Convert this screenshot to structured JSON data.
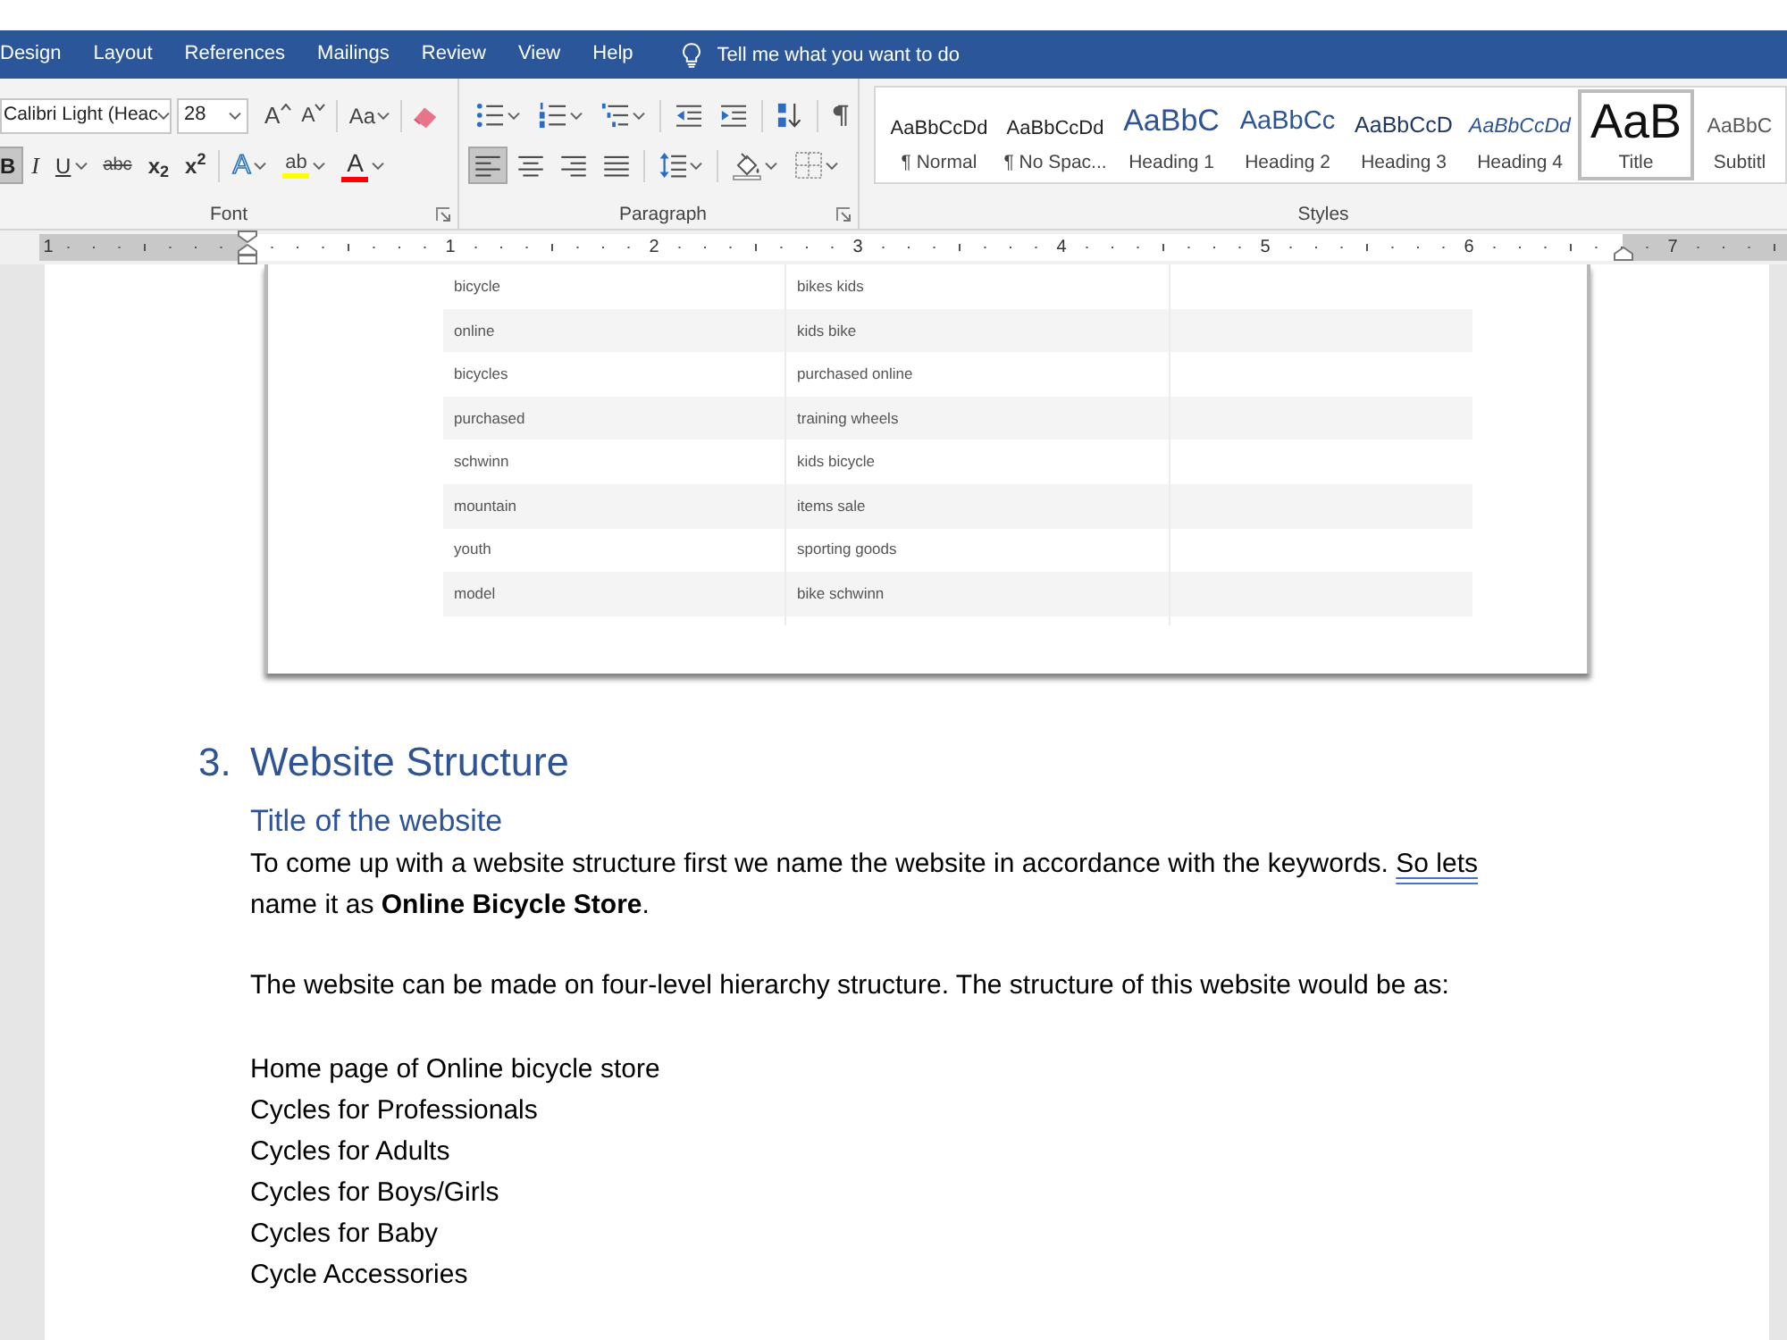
{
  "tabs": [
    {
      "label": "Design",
      "selected": false
    },
    {
      "label": "Layout",
      "selected": false
    },
    {
      "label": "References",
      "selected": false
    },
    {
      "label": "Mailings",
      "selected": false
    },
    {
      "label": "Review",
      "selected": false
    },
    {
      "label": "View",
      "selected": false
    },
    {
      "label": "Help",
      "selected": false
    }
  ],
  "tell_me": {
    "placeholder": "Tell me what you want to do"
  },
  "ribbon": {
    "font_group": {
      "label": "Font",
      "font_name": "Calibri Light (Heac",
      "font_size": "28",
      "row1": [
        {
          "kind": "grow",
          "label": "A",
          "menu": false
        },
        {
          "kind": "shrink",
          "label": "A",
          "menu": false
        },
        {
          "kind": "case",
          "label": "Aa",
          "menu": true
        },
        {
          "kind": "clear",
          "menu": false
        }
      ],
      "row2": [
        {
          "kind": "bold",
          "label": "B",
          "pressed": true,
          "menu": false
        },
        {
          "kind": "italic",
          "label": "I",
          "pressed": false,
          "menu": false
        },
        {
          "kind": "underline",
          "label": "U",
          "pressed": false,
          "menu": true
        },
        {
          "kind": "strikethrough",
          "label": "abc",
          "pressed": false,
          "menu": false
        },
        {
          "kind": "subscript",
          "label": "x$_{2}$",
          "pressed": false,
          "menu": false
        },
        {
          "kind": "superscript",
          "label": "x$^{2}$",
          "pressed": false,
          "menu": false
        },
        {
          "kind": "text_effects",
          "label": "A",
          "pressed": false,
          "menu": true
        },
        {
          "kind": "highlight",
          "label": "ab",
          "color": "#ffff00",
          "pressed": false,
          "menu": true
        },
        {
          "kind": "font_color",
          "label": "A",
          "color": "#ff0000",
          "pressed": false,
          "menu": true
        }
      ]
    },
    "paragraph_group": {
      "label": "Paragraph",
      "row1": [
        {
          "kind": "bullets",
          "menu": true
        },
        {
          "kind": "numbering",
          "menu": true
        },
        {
          "kind": "multilevel",
          "menu": true
        },
        {
          "kind": "decrease_indent",
          "menu": false
        },
        {
          "kind": "increase_indent",
          "menu": false
        },
        {
          "kind": "sort",
          "menu": false
        },
        {
          "kind": "show_marks",
          "menu": false
        }
      ],
      "row2": [
        {
          "kind": "align_left",
          "pressed": true,
          "menu": false
        },
        {
          "kind": "align_center",
          "pressed": false,
          "menu": false
        },
        {
          "kind": "align_right",
          "pressed": false,
          "menu": false
        },
        {
          "kind": "justify",
          "pressed": false,
          "menu": false
        },
        {
          "kind": "line_spacing",
          "pressed": false,
          "menu": true
        },
        {
          "kind": "shading",
          "pressed": false,
          "menu": true
        },
        {
          "kind": "borders",
          "pressed": false,
          "menu": true
        }
      ]
    },
    "styles_group": {
      "label": "Styles",
      "items": [
        {
          "kind": "normal",
          "preview": "AaBbCcDd",
          "name": "¶ Normal",
          "selected": false
        },
        {
          "kind": "no_spacing",
          "preview": "AaBbCcDd",
          "name": "¶ No Spac...",
          "selected": false
        },
        {
          "kind": "heading1",
          "preview": "AaBbC",
          "name": "Heading 1",
          "selected": false
        },
        {
          "kind": "heading2",
          "preview": "AaBbCc",
          "name": "Heading 2",
          "selected": false
        },
        {
          "kind": "heading3",
          "preview": "AaBbCcD",
          "name": "Heading 3",
          "selected": false
        },
        {
          "kind": "heading4",
          "preview": "AaBbCcDd",
          "name": "Heading 4",
          "selected": false
        },
        {
          "kind": "title",
          "preview": "AaB",
          "name": "Title",
          "selected": true
        },
        {
          "kind": "subtitle",
          "preview": "AaBbC",
          "name": "Subtitl",
          "selected": false
        }
      ]
    }
  },
  "ruler": {
    "marks": [
      "1",
      "1",
      "2",
      "3",
      "4",
      "5",
      "6",
      "7"
    ]
  },
  "document": {
    "table_image": {
      "rows": [
        [
          "bicycle",
          "bikes kids"
        ],
        [
          "online",
          "kids bike"
        ],
        [
          "bicycles",
          "purchased online"
        ],
        [
          "purchased",
          "training wheels"
        ],
        [
          "schwinn",
          "kids bicycle"
        ],
        [
          "mountain",
          "items sale"
        ],
        [
          "youth",
          "sporting goods"
        ],
        [
          "model",
          "bike schwinn"
        ]
      ]
    },
    "heading": {
      "number": "3.",
      "text": "Website Structure"
    },
    "subheading": "Title of the website",
    "paragraphs": [
      {
        "segments": [
          {
            "text": "To come up with a website structure first we name the website in accordance with the keywords. ",
            "flagged": false
          },
          {
            "text": "So lets",
            "flagged": true
          },
          {
            "text": " name it as **Online Bicycle Store**.",
            "flagged": false
          }
        ]
      },
      {
        "segments": [
          {
            "text": "The website can be made on four-level hierarchy structure. The structure of this website would be as:",
            "flagged": false
          }
        ]
      }
    ],
    "lines": [
      "Home page of Online bicycle store",
      "Cycles for Professionals",
      "Cycles for Adults",
      "Cycles for Boys/Girls",
      "Cycles for Baby",
      "Cycle Accessories"
    ]
  }
}
